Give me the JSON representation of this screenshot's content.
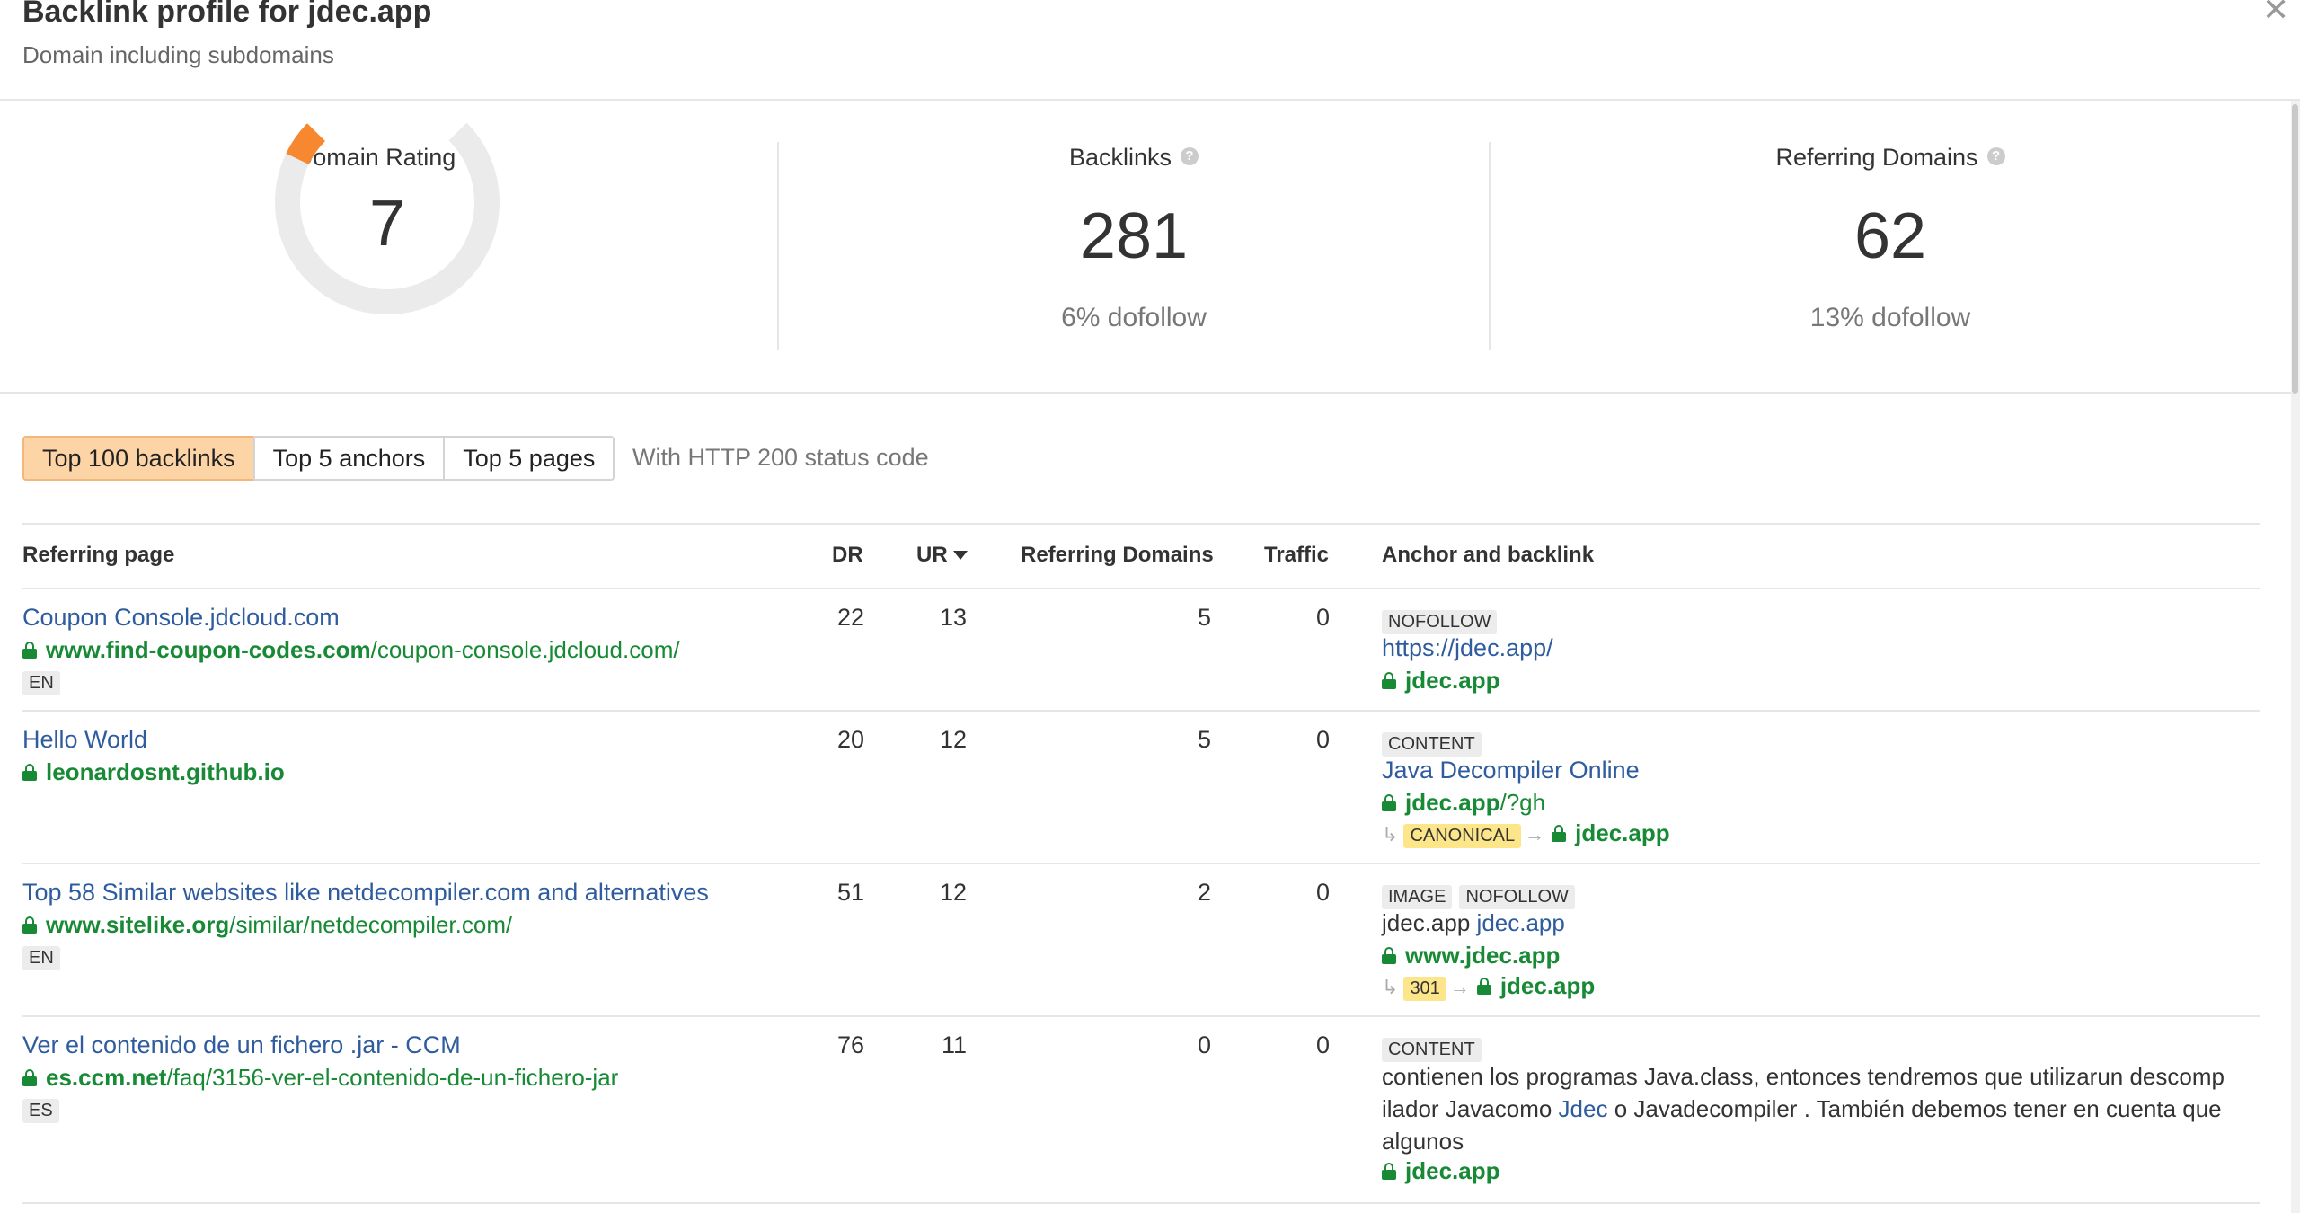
{
  "header": {
    "title": "Backlink profile for jdec.app",
    "subtitle": "Domain including subdomains",
    "close": "✕"
  },
  "metrics": {
    "domain_rating": {
      "label": "Domain Rating",
      "value": "7",
      "gauge_fraction": 0.07
    },
    "backlinks": {
      "label": "Backlinks",
      "value": "281",
      "sub": "6% dofollow"
    },
    "referring_domains": {
      "label": "Referring Domains",
      "value": "62",
      "sub": "13% dofollow"
    }
  },
  "tabs": [
    "Top 100 backlinks",
    "Top 5 anchors",
    "Top 5 pages"
  ],
  "status_note": "With HTTP 200 status code",
  "table": {
    "headers": {
      "referring_page": "Referring page",
      "dr": "DR",
      "ur": "UR",
      "referring_domains": "Referring Domains",
      "traffic": "Traffic",
      "anchor": "Anchor and backlink"
    },
    "rows": [
      {
        "title": "Coupon Console.jdcloud.com",
        "url_domain": "www.find-coupon-codes.com",
        "url_path": "/coupon-console.jdcloud.com/",
        "lang": "EN",
        "dr": "22",
        "ur": "13",
        "rd": "5",
        "traffic": "0",
        "badges": [
          "NOFOLLOW"
        ],
        "anchor_line": "https://jdec.app/",
        "target_domain": "jdec.app"
      },
      {
        "title": "Hello World",
        "url_domain": "leonardosnt.github.io",
        "dr": "20",
        "ur": "12",
        "rd": "5",
        "traffic": "0",
        "badges": [
          "CONTENT"
        ],
        "anchor_line": "Java Decompiler Online",
        "target_domain": "jdec.app",
        "target_path": "/?gh",
        "redirect_label": "CANONICAL",
        "redirect_target": "jdec.app"
      },
      {
        "title": "Top 58 Similar websites like netdecompiler.com and alternatives",
        "url_domain": "www.sitelike.org",
        "url_path": "/similar/netdecompiler.com/",
        "lang": "EN",
        "dr": "51",
        "ur": "12",
        "rd": "2",
        "traffic": "0",
        "badges": [
          "IMAGE",
          "NOFOLLOW"
        ],
        "anchor_plain": "jdec.app",
        "anchor_link": "jdec.app",
        "target_domain": "www.jdec.app",
        "redirect_label": "301",
        "redirect_target": "jdec.app"
      },
      {
        "title": "Ver el contenido de un fichero .jar - CCM",
        "url_domain": "es.ccm.net",
        "url_path": "/faq/3156-ver-el-contenido-de-un-fichero-jar",
        "lang": "ES",
        "dr": "76",
        "ur": "11",
        "rd": "0",
        "traffic": "0",
        "badges": [
          "CONTENT"
        ],
        "anchor_before": "contienen los programas Java.class, entonces tendremos que utilizarun descompilador Javacomo ",
        "anchor_link": "Jdec",
        "anchor_after": " o Javadecompiler . También debemos tener en cuenta que algunos",
        "target_domain": "jdec.app"
      }
    ]
  },
  "colors": {
    "accent_orange": "#f7882f",
    "gauge_track": "#ebebeb",
    "link_blue": "#2f5c9e",
    "url_green": "#188a35",
    "active_tab": "#fdd4a6"
  }
}
